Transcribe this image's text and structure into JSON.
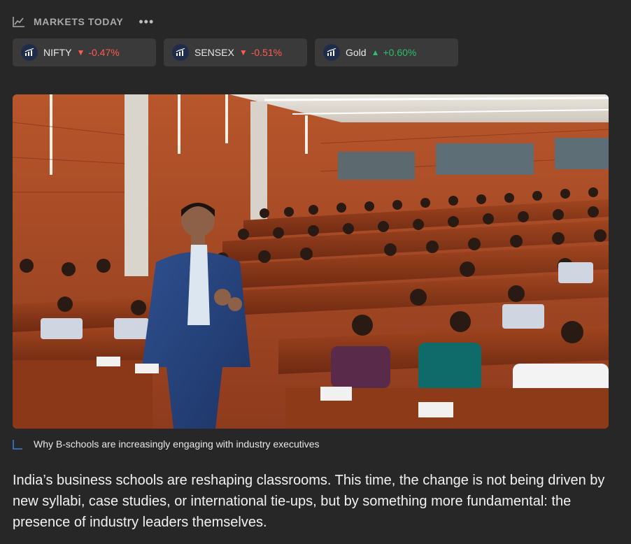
{
  "markets": {
    "title": "MARKETS TODAY",
    "more_label": "•••",
    "tickers": [
      {
        "name": "NIFTY",
        "direction": "down",
        "arrow": "▼",
        "change": "-0.47%"
      },
      {
        "name": "SENSEX",
        "direction": "down",
        "arrow": "▼",
        "change": "-0.51%"
      },
      {
        "name": "Gold",
        "direction": "up",
        "arrow": "▲",
        "change": "+0.60%"
      }
    ]
  },
  "image": {
    "caption": "Why B-schools are increasingly engaging with industry executives"
  },
  "article": {
    "lead": "India’s business schools are reshaping classrooms. This time, the change is not being driven by new syllabi, case studies, or international tie-ups, but by something more fundamental: the presence of industry leaders themselves."
  },
  "colors": {
    "background": "#272727",
    "ticker_bg": "#3a3a3a",
    "down": "#ff5b4f",
    "up": "#2ebd6b",
    "caption_accent": "#3d7bd6"
  }
}
